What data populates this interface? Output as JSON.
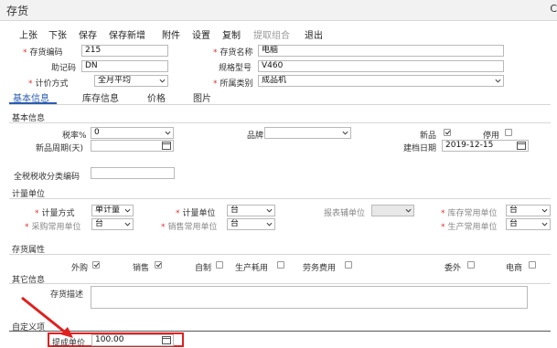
{
  "window": {
    "title": "存货",
    "edge_char": "C"
  },
  "toolbar": {
    "items": [
      "上张",
      "下张",
      "保存",
      "保存新增",
      "附件",
      "设置",
      "复制",
      "提取组合",
      "退出"
    ]
  },
  "header": {
    "code_label": "存货编码",
    "code_value": "215",
    "name_label": "存货名称",
    "name_value": "电脑",
    "mnemonic_label": "助记码",
    "mnemonic_value": "DN",
    "model_label": "规格型号",
    "model_value": "V460",
    "pricing_label": "计价方式",
    "pricing_value": "全月平均",
    "category_label": "所属类别",
    "category_value": "成品机"
  },
  "tabs": [
    "基本信息",
    "库存信息",
    "价格",
    "图片"
  ],
  "basic": {
    "section": "基本信息",
    "tax_label": "税率%",
    "tax_value": "0",
    "brand_label": "品牌",
    "brand_value": "",
    "new_label": "新品",
    "new_checked": true,
    "disabled_label": "停用",
    "disabled_checked": false,
    "newperiod_label": "新品周期(天)",
    "newperiod_value": "",
    "created_label": "建档日期",
    "created_value": "2019-12-15",
    "taxcode_label": "全税税收分类编码",
    "taxcode_value": ""
  },
  "units": {
    "section": "计量单位",
    "method_label": "计量方式",
    "method_value": "单计量",
    "unit_label": "计量单位",
    "unit_value": "台",
    "report_label": "报表辅单位",
    "report_value": "",
    "stock_label": "库存常用单位",
    "stock_value": "台",
    "purchase_label": "采购常用单位",
    "purchase_value": "台",
    "sales_label": "销售常用单位",
    "sales_value": "台",
    "production_label": "生产常用单位",
    "production_value": "台"
  },
  "attributes": {
    "section": "存货属性",
    "items": [
      {
        "label": "外购",
        "checked": true
      },
      {
        "label": "销售",
        "checked": true
      },
      {
        "label": "自制",
        "checked": false
      },
      {
        "label": "生产耗用",
        "checked": false
      },
      {
        "label": "劳务费用",
        "checked": false
      },
      {
        "label": "委外",
        "checked": false
      },
      {
        "label": "电商",
        "checked": false
      }
    ]
  },
  "other": {
    "section": "其它信息",
    "desc_label": "存货描述",
    "desc_value": ""
  },
  "custom": {
    "section": "自定义项",
    "commission_label": "提成单价",
    "commission_value": "100.00"
  },
  "colors": {
    "accent": "#2a5db0",
    "required": "#e03030",
    "highlight": "#e02020"
  }
}
